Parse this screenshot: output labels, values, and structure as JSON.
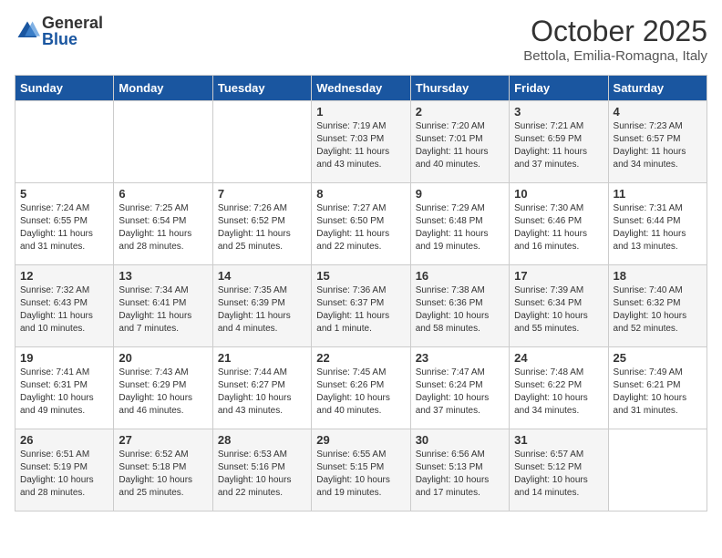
{
  "logo": {
    "general": "General",
    "blue": "Blue"
  },
  "title": "October 2025",
  "location": "Bettola, Emilia-Romagna, Italy",
  "days_of_week": [
    "Sunday",
    "Monday",
    "Tuesday",
    "Wednesday",
    "Thursday",
    "Friday",
    "Saturday"
  ],
  "weeks": [
    [
      {
        "day": "",
        "info": ""
      },
      {
        "day": "",
        "info": ""
      },
      {
        "day": "",
        "info": ""
      },
      {
        "day": "1",
        "info": "Sunrise: 7:19 AM\nSunset: 7:03 PM\nDaylight: 11 hours\nand 43 minutes."
      },
      {
        "day": "2",
        "info": "Sunrise: 7:20 AM\nSunset: 7:01 PM\nDaylight: 11 hours\nand 40 minutes."
      },
      {
        "day": "3",
        "info": "Sunrise: 7:21 AM\nSunset: 6:59 PM\nDaylight: 11 hours\nand 37 minutes."
      },
      {
        "day": "4",
        "info": "Sunrise: 7:23 AM\nSunset: 6:57 PM\nDaylight: 11 hours\nand 34 minutes."
      }
    ],
    [
      {
        "day": "5",
        "info": "Sunrise: 7:24 AM\nSunset: 6:55 PM\nDaylight: 11 hours\nand 31 minutes."
      },
      {
        "day": "6",
        "info": "Sunrise: 7:25 AM\nSunset: 6:54 PM\nDaylight: 11 hours\nand 28 minutes."
      },
      {
        "day": "7",
        "info": "Sunrise: 7:26 AM\nSunset: 6:52 PM\nDaylight: 11 hours\nand 25 minutes."
      },
      {
        "day": "8",
        "info": "Sunrise: 7:27 AM\nSunset: 6:50 PM\nDaylight: 11 hours\nand 22 minutes."
      },
      {
        "day": "9",
        "info": "Sunrise: 7:29 AM\nSunset: 6:48 PM\nDaylight: 11 hours\nand 19 minutes."
      },
      {
        "day": "10",
        "info": "Sunrise: 7:30 AM\nSunset: 6:46 PM\nDaylight: 11 hours\nand 16 minutes."
      },
      {
        "day": "11",
        "info": "Sunrise: 7:31 AM\nSunset: 6:44 PM\nDaylight: 11 hours\nand 13 minutes."
      }
    ],
    [
      {
        "day": "12",
        "info": "Sunrise: 7:32 AM\nSunset: 6:43 PM\nDaylight: 11 hours\nand 10 minutes."
      },
      {
        "day": "13",
        "info": "Sunrise: 7:34 AM\nSunset: 6:41 PM\nDaylight: 11 hours\nand 7 minutes."
      },
      {
        "day": "14",
        "info": "Sunrise: 7:35 AM\nSunset: 6:39 PM\nDaylight: 11 hours\nand 4 minutes."
      },
      {
        "day": "15",
        "info": "Sunrise: 7:36 AM\nSunset: 6:37 PM\nDaylight: 11 hours\nand 1 minute."
      },
      {
        "day": "16",
        "info": "Sunrise: 7:38 AM\nSunset: 6:36 PM\nDaylight: 10 hours\nand 58 minutes."
      },
      {
        "day": "17",
        "info": "Sunrise: 7:39 AM\nSunset: 6:34 PM\nDaylight: 10 hours\nand 55 minutes."
      },
      {
        "day": "18",
        "info": "Sunrise: 7:40 AM\nSunset: 6:32 PM\nDaylight: 10 hours\nand 52 minutes."
      }
    ],
    [
      {
        "day": "19",
        "info": "Sunrise: 7:41 AM\nSunset: 6:31 PM\nDaylight: 10 hours\nand 49 minutes."
      },
      {
        "day": "20",
        "info": "Sunrise: 7:43 AM\nSunset: 6:29 PM\nDaylight: 10 hours\nand 46 minutes."
      },
      {
        "day": "21",
        "info": "Sunrise: 7:44 AM\nSunset: 6:27 PM\nDaylight: 10 hours\nand 43 minutes."
      },
      {
        "day": "22",
        "info": "Sunrise: 7:45 AM\nSunset: 6:26 PM\nDaylight: 10 hours\nand 40 minutes."
      },
      {
        "day": "23",
        "info": "Sunrise: 7:47 AM\nSunset: 6:24 PM\nDaylight: 10 hours\nand 37 minutes."
      },
      {
        "day": "24",
        "info": "Sunrise: 7:48 AM\nSunset: 6:22 PM\nDaylight: 10 hours\nand 34 minutes."
      },
      {
        "day": "25",
        "info": "Sunrise: 7:49 AM\nSunset: 6:21 PM\nDaylight: 10 hours\nand 31 minutes."
      }
    ],
    [
      {
        "day": "26",
        "info": "Sunrise: 6:51 AM\nSunset: 5:19 PM\nDaylight: 10 hours\nand 28 minutes."
      },
      {
        "day": "27",
        "info": "Sunrise: 6:52 AM\nSunset: 5:18 PM\nDaylight: 10 hours\nand 25 minutes."
      },
      {
        "day": "28",
        "info": "Sunrise: 6:53 AM\nSunset: 5:16 PM\nDaylight: 10 hours\nand 22 minutes."
      },
      {
        "day": "29",
        "info": "Sunrise: 6:55 AM\nSunset: 5:15 PM\nDaylight: 10 hours\nand 19 minutes."
      },
      {
        "day": "30",
        "info": "Sunrise: 6:56 AM\nSunset: 5:13 PM\nDaylight: 10 hours\nand 17 minutes."
      },
      {
        "day": "31",
        "info": "Sunrise: 6:57 AM\nSunset: 5:12 PM\nDaylight: 10 hours\nand 14 minutes."
      },
      {
        "day": "",
        "info": ""
      }
    ]
  ]
}
